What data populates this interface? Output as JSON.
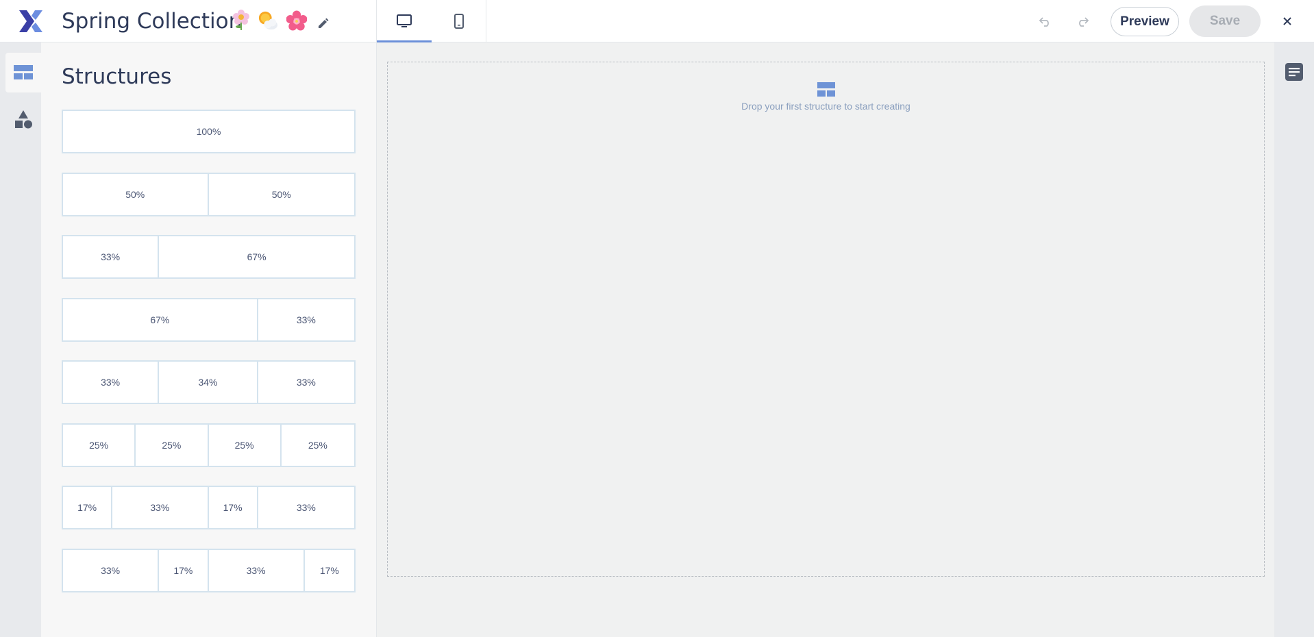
{
  "header": {
    "title": "Spring Collection",
    "title_emojis": [
      "flower-emoji",
      "sun-behind-cloud-emoji",
      "cherry-blossom-emoji"
    ],
    "device_tabs": [
      {
        "name": "desktop",
        "icon": "monitor-icon",
        "active": true
      },
      {
        "name": "mobile",
        "icon": "phone-icon",
        "active": false
      }
    ],
    "preview_label": "Preview",
    "save_label": "Save",
    "accent_color": "#6a8fd9"
  },
  "left_rail": {
    "items": [
      {
        "icon": "structures-icon",
        "active": true
      },
      {
        "icon": "shapes-icon",
        "active": false
      }
    ]
  },
  "structures_panel": {
    "title": "Structures",
    "structures": [
      {
        "columns": [
          "100%"
        ]
      },
      {
        "columns": [
          "50%",
          "50%"
        ]
      },
      {
        "columns": [
          "33%",
          "67%"
        ]
      },
      {
        "columns": [
          "67%",
          "33%"
        ]
      },
      {
        "columns": [
          "33%",
          "34%",
          "33%"
        ]
      },
      {
        "columns": [
          "25%",
          "25%",
          "25%",
          "25%"
        ]
      },
      {
        "columns": [
          "17%",
          "33%",
          "17%",
          "33%"
        ]
      },
      {
        "columns": [
          "33%",
          "17%",
          "33%",
          "17%"
        ]
      }
    ]
  },
  "canvas": {
    "empty_message": "Drop your first structure to start creating",
    "empty_icon": "structure-icon"
  },
  "right_rail": {
    "icon": "document-icon"
  }
}
